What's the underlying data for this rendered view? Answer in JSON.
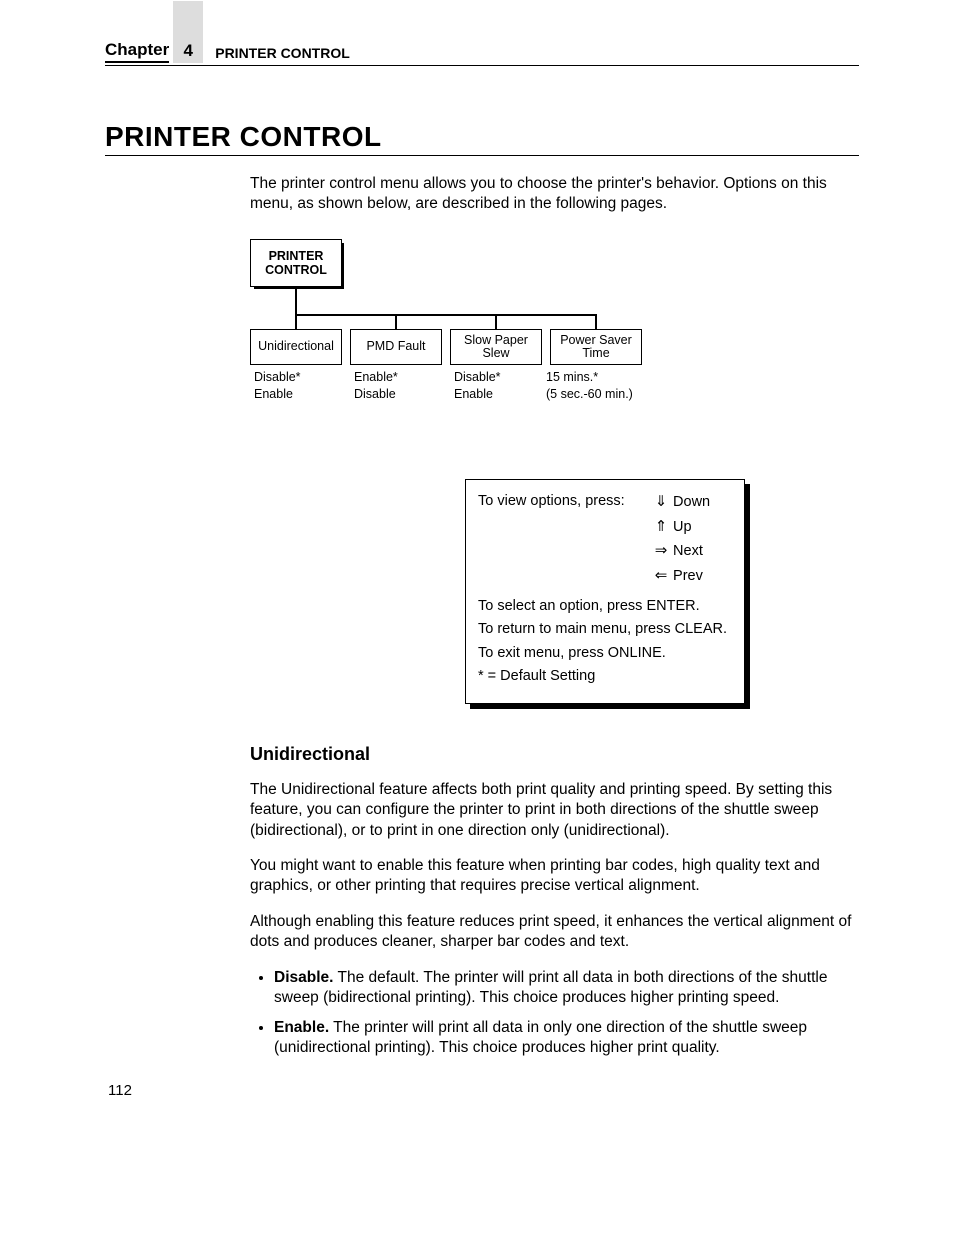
{
  "header": {
    "chapter_label": "Chapter",
    "chapter_num": "4",
    "title": "PRINTER CONTROL"
  },
  "main_title": "PRINTER CONTROL",
  "intro": "The printer control menu allows you to choose the printer's behavior. Options on this menu, as shown below, are described in the following pages.",
  "menu_tree": {
    "root": "PRINTER CONTROL",
    "children": [
      {
        "label": "Unidirectional",
        "opt1": "Disable*",
        "opt2": "Enable"
      },
      {
        "label": "PMD Fault",
        "opt1": "Enable*",
        "opt2": "Disable"
      },
      {
        "label": "Slow Paper Slew",
        "opt1": "Disable*",
        "opt2": "Enable"
      },
      {
        "label": "Power Saver Time",
        "opt1": "15 mins.*",
        "opt2": "(5 sec.-60 min.)"
      }
    ]
  },
  "instructions": {
    "view_label": "To view options, press:",
    "down": "Down",
    "up": "Up",
    "next": "Next",
    "prev": "Prev",
    "select": "To select an option, press ENTER.",
    "return": "To return to main menu, press CLEAR.",
    "exit": "To exit menu, press ONLINE.",
    "default_note": "* = Default Setting"
  },
  "section": {
    "heading": "Unidirectional",
    "p1": "The Unidirectional feature affects both print quality and printing speed. By setting this feature, you can configure the printer to print in both directions of the shuttle sweep (bidirectional), or to print in one direction only (unidirectional).",
    "p2": "You might want to enable this feature when printing bar codes, high quality text and graphics, or other printing that requires precise vertical alignment.",
    "p3": "Although enabling this feature reduces print speed, it enhances the vertical alignment of dots and produces cleaner, sharper bar codes and text.",
    "bullets": [
      {
        "term": "Disable.",
        "text": " The default. The printer will print all data in both directions of the shuttle sweep (bidirectional printing). This choice produces higher printing speed."
      },
      {
        "term": "Enable.",
        "text": " The printer will print all data in only one direction of the shuttle sweep (unidirectional printing). This choice produces higher print quality."
      }
    ]
  },
  "page_number": "112"
}
